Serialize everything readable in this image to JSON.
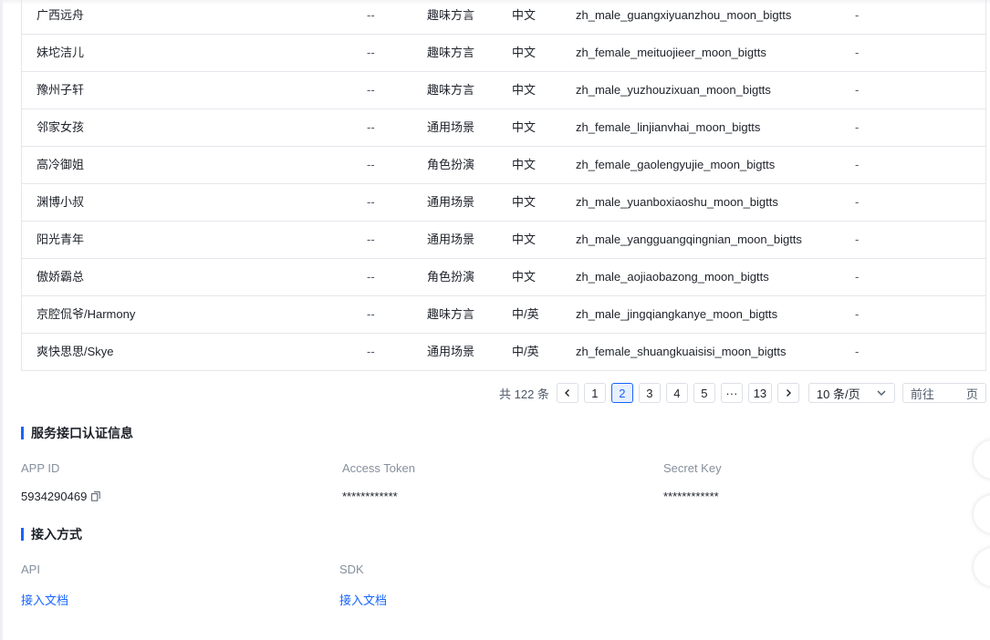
{
  "voices": {
    "rows": [
      {
        "name": "广西远舟",
        "dash": "--",
        "scene": "趣味方言",
        "lang": "中文",
        "voice_id": "zh_male_guangxiyuanzhou_moon_bigtts",
        "extra": "-"
      },
      {
        "name": "妹坨洁儿",
        "dash": "--",
        "scene": "趣味方言",
        "lang": "中文",
        "voice_id": "zh_female_meituojieer_moon_bigtts",
        "extra": "-"
      },
      {
        "name": "豫州子轩",
        "dash": "--",
        "scene": "趣味方言",
        "lang": "中文",
        "voice_id": "zh_male_yuzhouzixuan_moon_bigtts",
        "extra": "-"
      },
      {
        "name": "邻家女孩",
        "dash": "--",
        "scene": "通用场景",
        "lang": "中文",
        "voice_id": "zh_female_linjianvhai_moon_bigtts",
        "extra": "-"
      },
      {
        "name": "高冷御姐",
        "dash": "--",
        "scene": "角色扮演",
        "lang": "中文",
        "voice_id": "zh_female_gaolengyujie_moon_bigtts",
        "extra": "-"
      },
      {
        "name": "渊博小叔",
        "dash": "--",
        "scene": "通用场景",
        "lang": "中文",
        "voice_id": "zh_male_yuanboxiaoshu_moon_bigtts",
        "extra": "-"
      },
      {
        "name": "阳光青年",
        "dash": "--",
        "scene": "通用场景",
        "lang": "中文",
        "voice_id": "zh_male_yangguangqingnian_moon_bigtts",
        "extra": "-"
      },
      {
        "name": "傲娇霸总",
        "dash": "--",
        "scene": "角色扮演",
        "lang": "中文",
        "voice_id": "zh_male_aojiaobazong_moon_bigtts",
        "extra": "-"
      },
      {
        "name": "京腔侃爷/Harmony",
        "dash": "--",
        "scene": "趣味方言",
        "lang": "中/英",
        "voice_id": "zh_male_jingqiangkanye_moon_bigtts",
        "extra": "-"
      },
      {
        "name": "爽快思思/Skye",
        "dash": "--",
        "scene": "通用场景",
        "lang": "中/英",
        "voice_id": "zh_female_shuangkuaisisi_moon_bigtts",
        "extra": "-"
      }
    ]
  },
  "pagination": {
    "total_label": "共 122 条",
    "pages": [
      "1",
      "2",
      "3",
      "4",
      "5",
      "···",
      "13"
    ],
    "current_page": "2",
    "page_size_label": "10 条/页",
    "jump_prefix": "前往",
    "jump_suffix": "页"
  },
  "auth_section": {
    "title": "服务接口认证信息",
    "app_id_label": "APP ID",
    "app_id_value": "5934290469",
    "access_token_label": "Access Token",
    "access_token_value": "************",
    "secret_key_label": "Secret Key",
    "secret_key_value": "************"
  },
  "access_section": {
    "title": "接入方式",
    "api_label": "API",
    "api_link": "接入文档",
    "sdk_label": "SDK",
    "sdk_link": "接入文档"
  },
  "colors": {
    "accent": "#1664ff",
    "border": "#e5e6eb",
    "muted_text": "#86909c"
  }
}
